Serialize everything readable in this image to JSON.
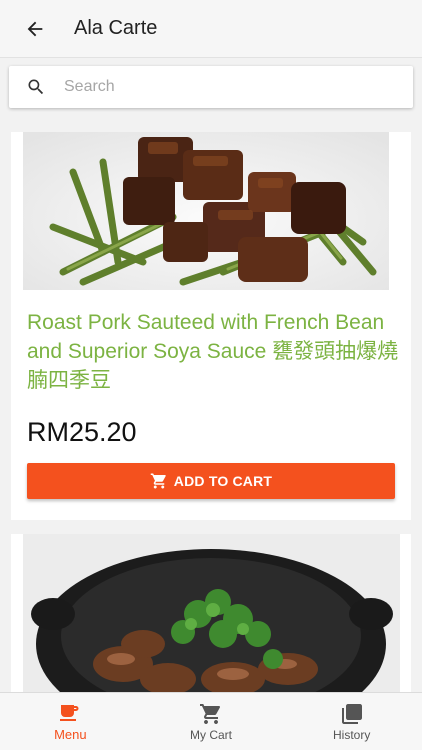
{
  "appbar": {
    "title": "Ala Carte"
  },
  "search": {
    "placeholder": "Search"
  },
  "items": [
    {
      "name": "Roast Pork Sauteed with French Bean and Superior Soya Sauce 甕發頭抽爆燒腩四季豆",
      "price": "RM25.20",
      "button_label": "ADD TO CART"
    }
  ],
  "bottom_nav": [
    {
      "label": "Menu",
      "icon": "coffee-cup-icon",
      "active": true
    },
    {
      "label": "My Cart",
      "icon": "shopping-cart-icon",
      "active": false
    },
    {
      "label": "History",
      "icon": "stacked-pages-icon",
      "active": false
    }
  ],
  "colors": {
    "accent": "#f4511e",
    "dish_name": "#7cb342",
    "price": "#111111"
  }
}
